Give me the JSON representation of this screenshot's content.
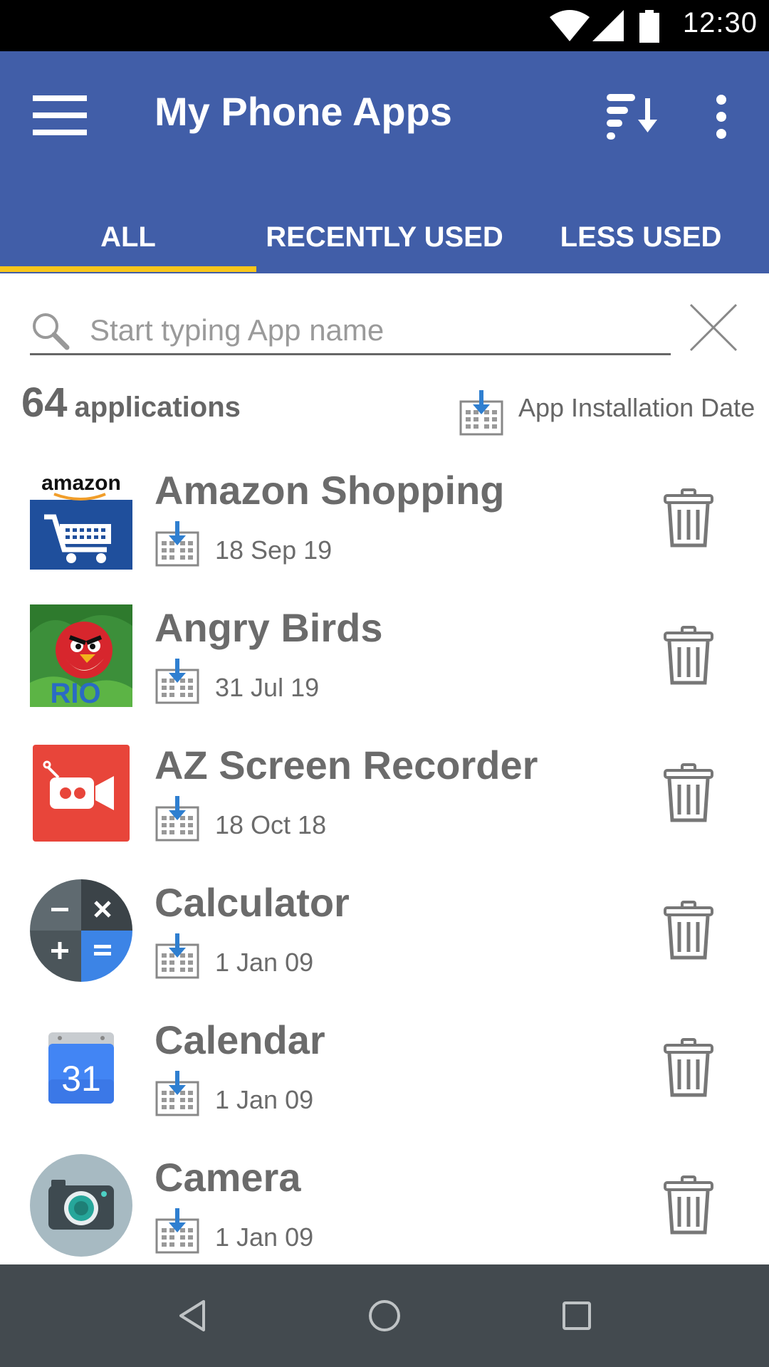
{
  "status_bar": {
    "time": "12:30"
  },
  "app_bar": {
    "title": "My Phone Apps"
  },
  "tabs": [
    {
      "label": "ALL",
      "selected": true
    },
    {
      "label": "RECENTLY USED",
      "selected": false
    },
    {
      "label": "LESS USED",
      "selected": false
    }
  ],
  "search": {
    "placeholder": "Start typing App name",
    "value": ""
  },
  "summary": {
    "count": "64",
    "count_label": "applications",
    "sort_label": "App Installation Date"
  },
  "apps": [
    {
      "name": "Amazon Shopping",
      "date": "18 Sep 19",
      "icon": "amazon-icon"
    },
    {
      "name": "Angry Birds",
      "date": "31 Jul 19",
      "icon": "angry-birds-icon"
    },
    {
      "name": "AZ Screen Recorder",
      "date": "18 Oct 18",
      "icon": "screen-recorder-icon"
    },
    {
      "name": "Calculator",
      "date": "1 Jan 09",
      "icon": "calculator-icon"
    },
    {
      "name": "Calendar",
      "date": "1 Jan 09",
      "icon": "calendar-icon"
    },
    {
      "name": "Camera",
      "date": "1 Jan 09",
      "icon": "camera-icon"
    }
  ],
  "icon_labels": {
    "amazon": "amazon",
    "calendar_day": "31",
    "angry_birds_text": "RIO"
  },
  "colors": {
    "app_bar": "#415EA8",
    "tab_indicator": "#F7C51A",
    "text_gray": "#6b6b6b",
    "nav_bar": "#434A4F"
  }
}
